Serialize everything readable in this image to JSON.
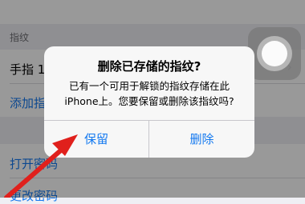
{
  "settings": {
    "section_label": "指纹",
    "fingerprint_row": "手指 1",
    "add_fingerprint": "添加指纹…",
    "open_passcode": "打开密码",
    "change_passcode": "更改密码",
    "chevron": "›"
  },
  "alert": {
    "title": "删除已存储的指纹?",
    "message_line1": "已有一个可用于解锁的指纹存储在此",
    "message_line2": "iPhone上。您要保留或删除该指纹吗?",
    "keep_label": "保留",
    "delete_label": "删除"
  },
  "colors": {
    "accent": "#1479f0",
    "annotation_arrow": "#e0201c"
  },
  "icons": {
    "assistive_touch": "assistive-touch-icon",
    "annotation": "red-arrow-icon"
  }
}
